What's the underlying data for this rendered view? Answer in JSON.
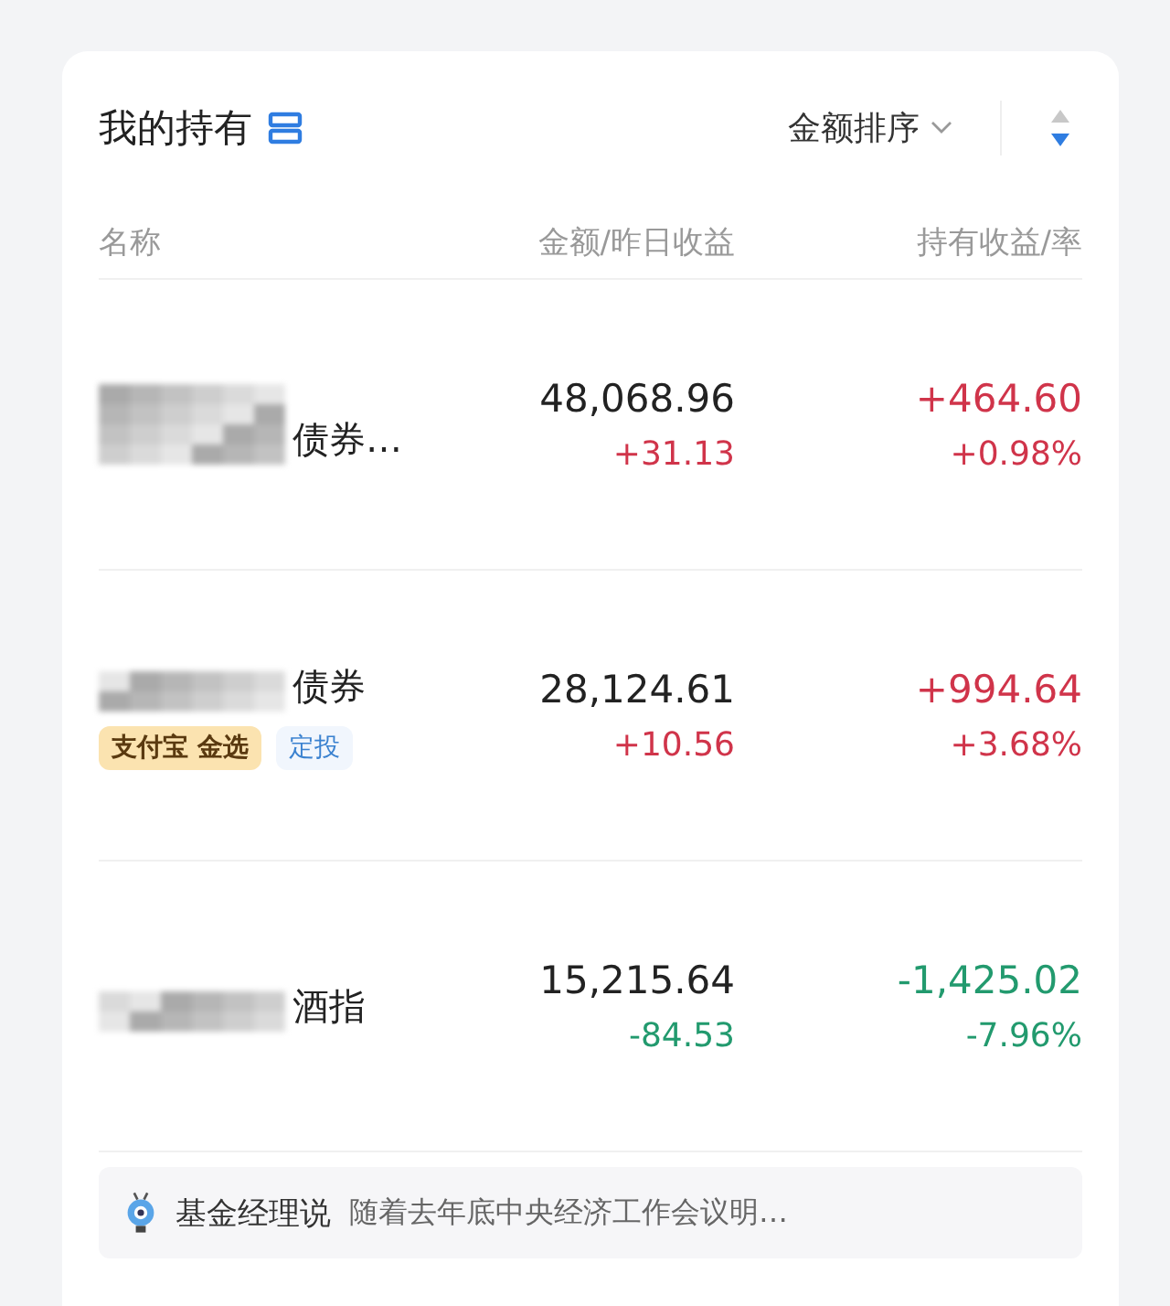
{
  "header": {
    "title": "我的持有",
    "sort_label": "金额排序",
    "descending": true
  },
  "columns": [
    "名称",
    "金额/昨日收益",
    "持有收益/率"
  ],
  "holdings": [
    {
      "name_visible": "债券…",
      "gain": true,
      "amount": "48,068.96",
      "yesterday": "+31.13",
      "profit": "+464.60",
      "rate": "+0.98%"
    },
    {
      "name_visible": "债券",
      "gain": true,
      "amount": "28,124.61",
      "yesterday": "+10.56",
      "profit": "+994.64",
      "rate": "+3.68%",
      "tags": [
        {
          "kind": "gold",
          "label": "支付宝 金选"
        },
        {
          "kind": "plain",
          "label": "定投"
        }
      ]
    },
    {
      "name_visible": "酒指",
      "gain": false,
      "amount": "15,215.64",
      "yesterday": "-84.53",
      "profit": "-1,425.02",
      "rate": "-7.96%"
    }
  ],
  "manager_note": {
    "label": "基金经理说",
    "text": "随着去年底中央经济工作会议明…"
  }
}
